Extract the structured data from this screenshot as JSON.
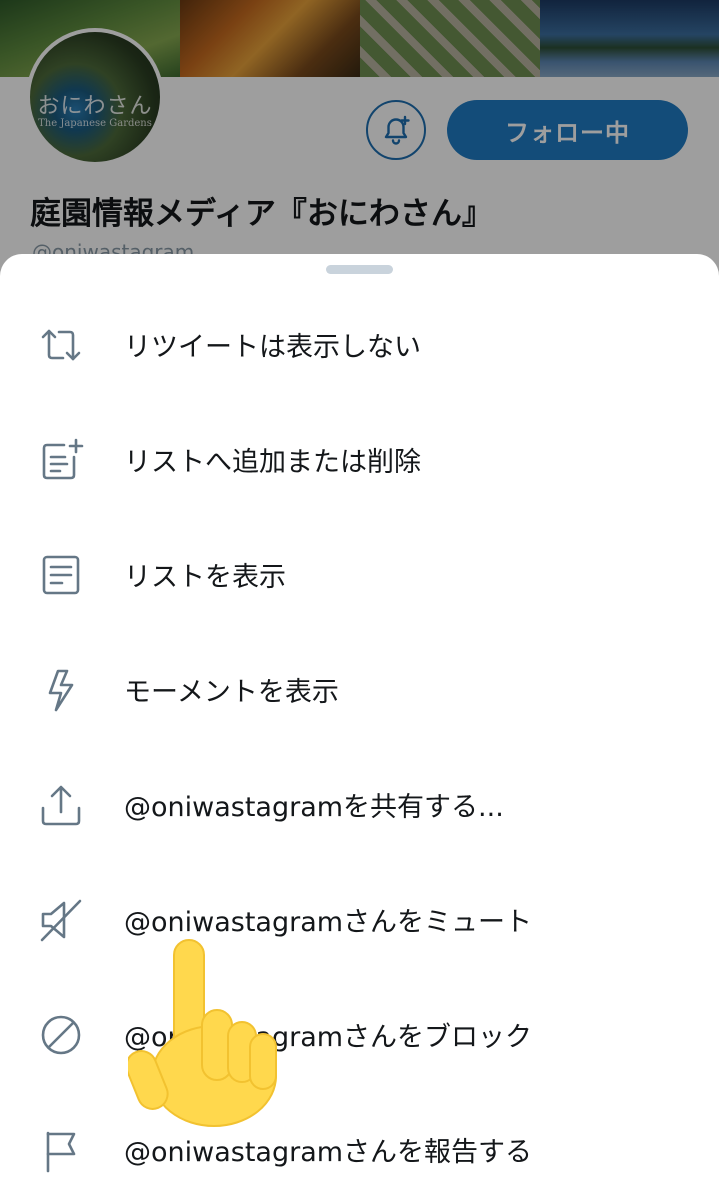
{
  "profile": {
    "avatar_title": "おにわさん",
    "avatar_subtitle": "The Japanese Gardens",
    "follow_label": "フォロー中",
    "name": "庭園情報メディア『おにわさん』",
    "handle": "@oniwastagram"
  },
  "menu": {
    "items": [
      {
        "label": "リツイートは表示しない",
        "icon": "retweet-icon"
      },
      {
        "label": "リストへ追加または削除",
        "icon": "list-add-icon"
      },
      {
        "label": "リストを表示",
        "icon": "list-icon"
      },
      {
        "label": "モーメントを表示",
        "icon": "lightning-icon"
      },
      {
        "label": "@oniwastagramを共有する...",
        "icon": "share-icon"
      },
      {
        "label": "@oniwastagramさんをミュート",
        "icon": "mute-icon"
      },
      {
        "label": "@oniwastagramさんをブロック",
        "icon": "block-icon"
      },
      {
        "label": "@oniwastagramさんを報告する",
        "icon": "flag-icon"
      }
    ]
  },
  "colors": {
    "accent": "#1f7bc3",
    "icon_gray": "#657786",
    "text": "#14171a",
    "pointer": "#ffd84d"
  }
}
